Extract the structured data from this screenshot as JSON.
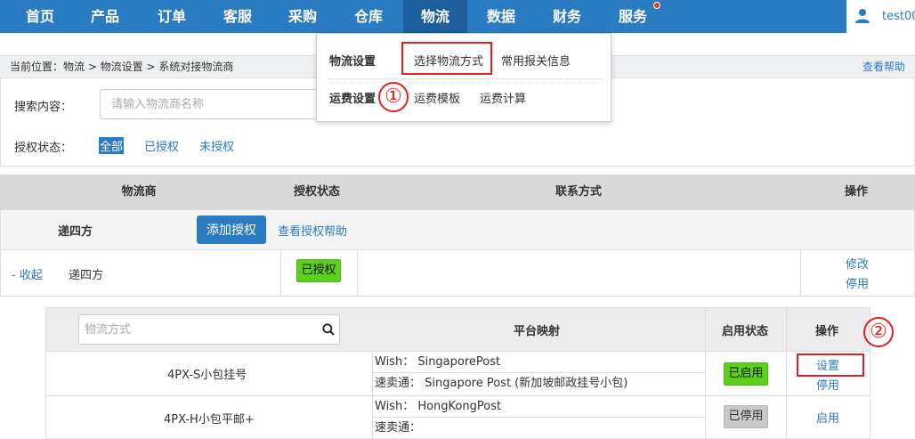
{
  "nav": {
    "items": [
      {
        "label": "首页"
      },
      {
        "label": "产品"
      },
      {
        "label": "订单"
      },
      {
        "label": "客服"
      },
      {
        "label": "采购"
      },
      {
        "label": "仓库"
      },
      {
        "label": "物流"
      },
      {
        "label": "数据"
      },
      {
        "label": "财务"
      },
      {
        "label": "服务"
      }
    ],
    "active": "物流",
    "user": "test00"
  },
  "breadcrumb": {
    "text": "当前位置：物流 > 物流设置 > 系统对接物流商",
    "help": "查看帮助"
  },
  "search": {
    "label": "搜索内容：",
    "placeholder": "请输入物流商名称",
    "auth_label": "授权状态：",
    "filters": [
      "全部",
      "已授权",
      "未授权"
    ],
    "selected_filter": "全部"
  },
  "dropdown": {
    "logistics_settings": "物流设置",
    "select_method": "选择物流方式",
    "customs_info": "常用报关信息",
    "freight_settings": "运费设置",
    "freight_template": "运费模板",
    "freight_calc": "运费计算"
  },
  "table": {
    "headers": [
      "物流商",
      "授权状态",
      "联系方式",
      "操作"
    ],
    "group": {
      "name": "递四方",
      "add_auth": "添加授权",
      "auth_help": "查看授权帮助"
    },
    "row": {
      "collapse": "- 收起",
      "name": "递四方",
      "status": "已授权",
      "actions": [
        "修改",
        "停用"
      ]
    }
  },
  "subtable": {
    "search_placeholder": "物流方式",
    "headers": [
      "平台映射",
      "启用状态",
      "操作"
    ],
    "rows": [
      {
        "name": "4PX-S小包挂号",
        "mappings": [
          "Wish： SingaporePost",
          "速卖通： Singapore Post (新加坡邮政挂号小包)"
        ],
        "status": "已启用",
        "status_color": "#5cd11b",
        "actions": [
          "设置",
          "停用"
        ]
      },
      {
        "name": "4PX-H小包平邮+",
        "mappings": [
          "Wish： HongKongPost",
          "速卖通："
        ],
        "status": "已停用",
        "status_color": "#c9c9c9",
        "actions": [
          "启用"
        ]
      }
    ]
  },
  "annotations": {
    "one": "①",
    "two": "②"
  }
}
